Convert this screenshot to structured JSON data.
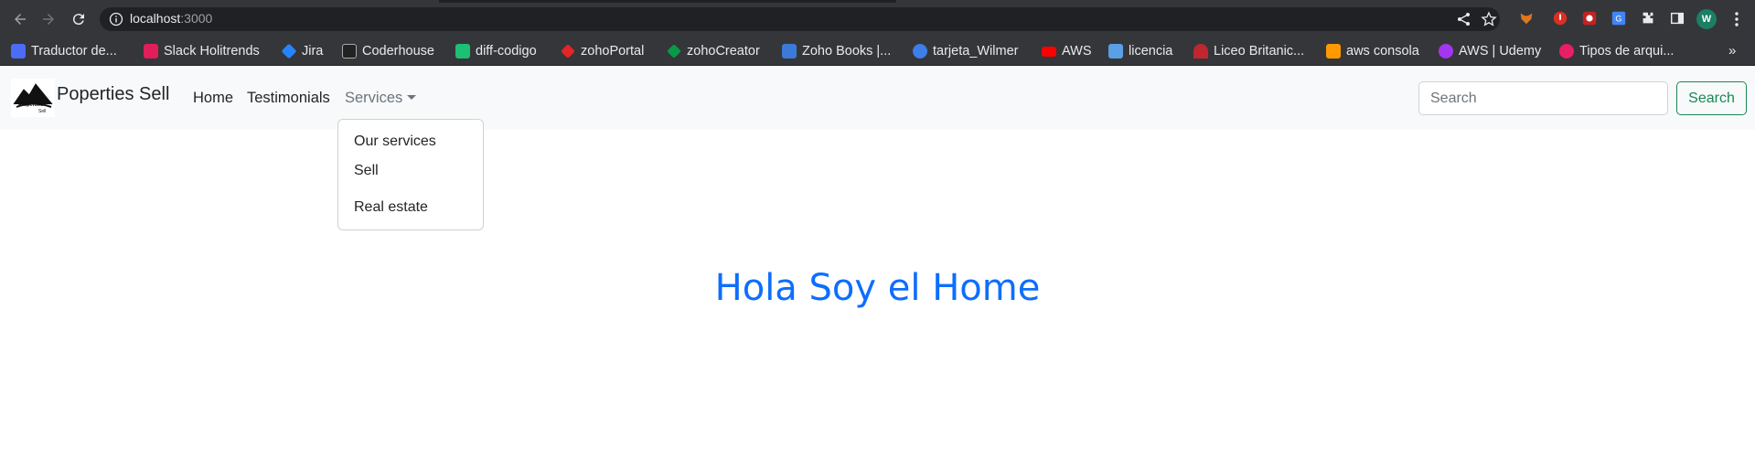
{
  "browser": {
    "url_host": "localhost",
    "url_port": ":3000",
    "avatar_letter": "W"
  },
  "bookmarks": [
    {
      "label": "Traductor de...",
      "color": "#4a6cf7"
    },
    {
      "label": "Slack Holitrends",
      "color": "#e01e5a"
    },
    {
      "label": "Jira",
      "color": "#2684ff"
    },
    {
      "label": "Coderhouse",
      "color": "#222222"
    },
    {
      "label": "diff-codigo",
      "color": "#1dbf73"
    },
    {
      "label": "zohoPortal",
      "color": "#e42527"
    },
    {
      "label": "zohoCreator",
      "color": "#089949"
    },
    {
      "label": "Zoho Books |...",
      "color": "#3c7ad9"
    },
    {
      "label": "tarjeta_Wilmer",
      "color": "#3d7ee8"
    },
    {
      "label": "AWS",
      "color": "#ff0000"
    },
    {
      "label": "licencia",
      "color": "#5aa0e6"
    },
    {
      "label": "Liceo Britanic...",
      "color": "#c0262d"
    },
    {
      "label": "aws consola",
      "color": "#ff9900"
    },
    {
      "label": "AWS | Udemy",
      "color": "#a435f0"
    },
    {
      "label": "Tipos de arqui...",
      "color": "#e91e63"
    }
  ],
  "bookmarks_more": "»",
  "navbar": {
    "brand": "Poperties Sell",
    "logo_text_line1": "Properties",
    "logo_text_line2": "Sell",
    "links": {
      "home": "Home",
      "testimonials": "Testimonials",
      "services": "Services"
    },
    "search_placeholder": "Search",
    "search_button": "Search",
    "accent_color": "#198754"
  },
  "dropdown": {
    "items": [
      "Our services",
      "Sell",
      "Real estate"
    ]
  },
  "main": {
    "heading": "Hola Soy el Home",
    "heading_color": "#0d6efd"
  }
}
